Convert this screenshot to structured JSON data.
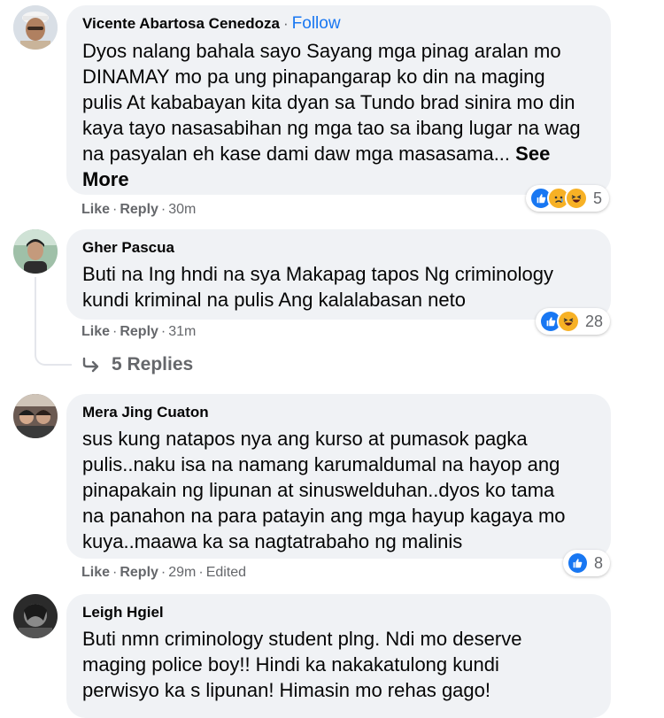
{
  "comments": [
    {
      "author": "Vicente Abartosa Cenedoza",
      "follow_label": "Follow",
      "text_lines": [
        "Dyos nalang bahala sayo Sayang mga pinag aralan mo",
        "DINAMAY mo pa ung pinapangarap ko din na maging",
        "pulis At kababayan kita dyan sa Tundo brad sinira mo din",
        "kaya tayo nasasabihan ng mga tao sa ibang lugar na wag",
        "na pasyalan eh kase dami daw mga masasama..."
      ],
      "see_label": "See",
      "more_label": "More",
      "like_label": "Like",
      "reply_label": "Reply",
      "time": "30m",
      "reaction_count": "5",
      "reaction_icons": [
        "like-icon",
        "sad-icon",
        "haha-icon"
      ]
    },
    {
      "author": "Gher Pascua",
      "text_lines": [
        "Buti na Ing hndi na sya Makapag tapos Ng criminology",
        "kundi kriminal na pulis Ang kalalabasan neto"
      ],
      "like_label": "Like",
      "reply_label": "Reply",
      "time": "31m",
      "reaction_count": "28",
      "reaction_icons": [
        "like-icon",
        "haha-icon"
      ],
      "replies_label": "5 Replies"
    },
    {
      "author": "Mera Jing Cuaton",
      "text_lines": [
        "sus kung natapos nya ang kurso at pumasok pagka",
        "pulis..naku isa na namang karumaldumal na hayop ang",
        "pinapakain ng lipunan at sinuswelduhan..dyos ko tama",
        "na panahon na para patayin ang mga hayup kagaya mo",
        "kuya..maawa ka sa nagtatrabaho ng malinis"
      ],
      "like_label": "Like",
      "reply_label": "Reply",
      "time": "29m",
      "edited_label": "Edited",
      "reaction_count": "8",
      "reaction_icons": [
        "like-icon"
      ]
    },
    {
      "author": "Leigh Hgiel",
      "text_lines": [
        "Buti nmn criminology student plng. Ndi mo deserve",
        "maging police boy!! Hindi ka nakakatulong kundi",
        "perwisyo ka s lipunan! Himasin mo rehas gago!"
      ]
    }
  ],
  "colors": {
    "bubble": "#f0f2f5",
    "text": "#050505",
    "meta": "#65676b",
    "link": "#1877f2",
    "like": "#1877f2",
    "emoji": "#f7b125"
  }
}
